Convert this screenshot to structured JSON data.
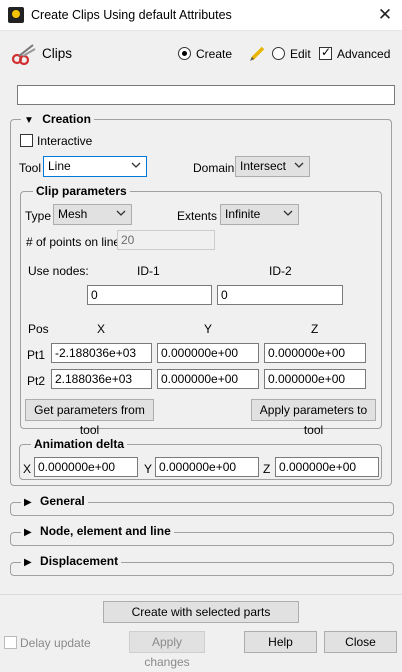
{
  "window": {
    "title": "Create Clips Using default Attributes",
    "close_glyph": "✕"
  },
  "header": {
    "label": "Clips",
    "mode_create": "Create",
    "mode_edit": "Edit",
    "advanced": "Advanced",
    "mode_selected": "Create",
    "advanced_checked": true
  },
  "name_field": {
    "value": ""
  },
  "creation": {
    "title": "Creation",
    "interactive_label": "Interactive",
    "interactive_checked": false,
    "tool_label": "Tool",
    "tool_value": "Line",
    "domain_label": "Domain",
    "domain_value": "Intersect"
  },
  "clip_params": {
    "title": "Clip parameters",
    "type_label": "Type",
    "type_value": "Mesh",
    "extents_label": "Extents",
    "extents_value": "Infinite",
    "points_label": "# of points on line",
    "points_value": "20",
    "use_nodes_label": "Use nodes:",
    "id1_label": "ID-1",
    "id2_label": "ID-2",
    "id1_value": "0",
    "id2_value": "0",
    "pos_label": "Pos",
    "x_label": "X",
    "y_label": "Y",
    "z_label": "Z",
    "pt1_label": "Pt1",
    "pt2_label": "Pt2",
    "pt1": {
      "x": "-2.188036e+03",
      "y": "0.000000e+00",
      "z": "0.000000e+00"
    },
    "pt2": {
      "x": "2.188036e+03",
      "y": "0.000000e+00",
      "z": "0.000000e+00"
    },
    "get_btn": "Get parameters from tool",
    "apply_btn": "Apply parameters to tool"
  },
  "animation": {
    "title": "Animation delta",
    "x_label": "X",
    "y_label": "Y",
    "z_label": "Z",
    "x_value": "0.000000e+00",
    "y_value": "0.000000e+00",
    "z_value": "0.000000e+00"
  },
  "sections": {
    "general": "General",
    "node": "Node, element and line",
    "displacement": "Displacement"
  },
  "footer": {
    "create_btn": "Create with selected parts",
    "delay_label": "Delay update",
    "apply_changes": "Apply changes",
    "help": "Help",
    "close": "Close"
  },
  "colors": {
    "focus_blue": "#0078d7",
    "window_bg": "#f0f0f0"
  }
}
